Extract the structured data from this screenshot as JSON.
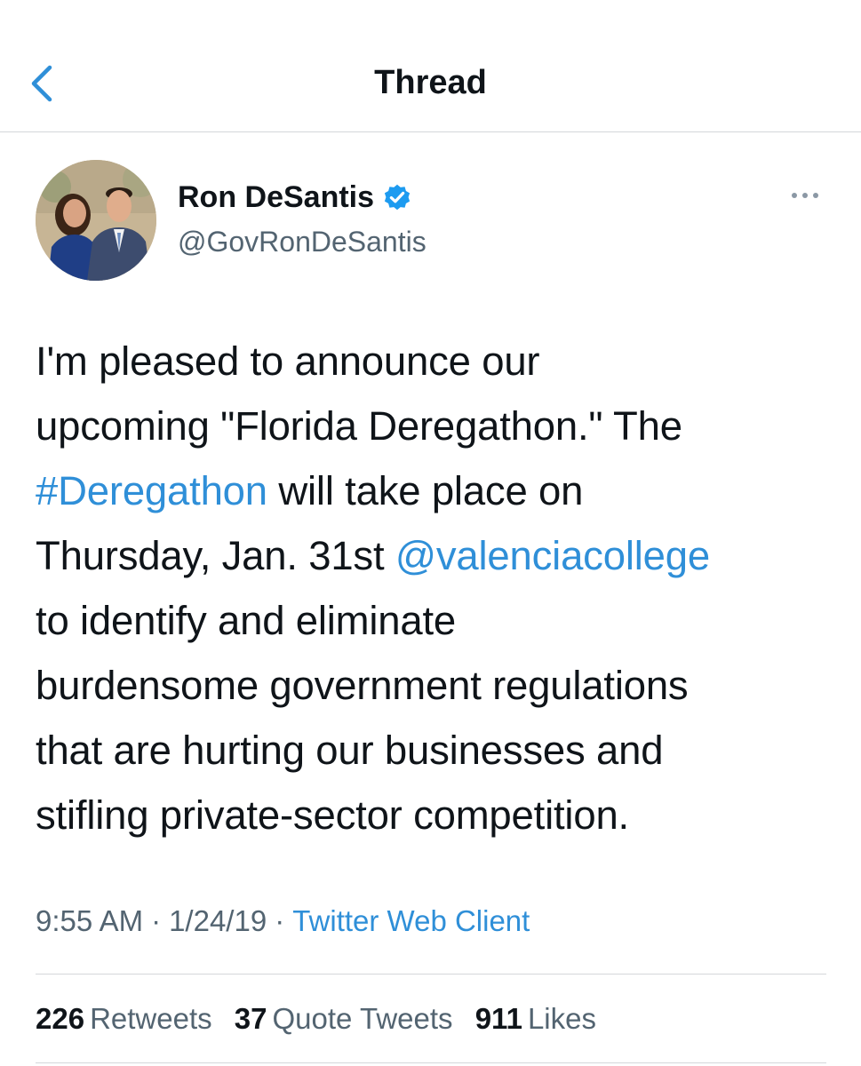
{
  "header": {
    "title": "Thread",
    "back_icon": "chevron-left-icon"
  },
  "author": {
    "display_name": "Ron DeSantis",
    "handle": "@GovRonDeSantis",
    "verified_icon": "verified-badge-icon",
    "more_icon": "more-horizontal-icon"
  },
  "tweet": {
    "segments": [
      {
        "text": "I'm pleased to announce our",
        "type": "text"
      },
      {
        "text": "upcoming \"Florida Deregathon.\" The",
        "type": "text"
      },
      {
        "text": "#Deregathon",
        "type": "hashtag"
      },
      {
        "text": " will take place on",
        "type": "text"
      },
      {
        "text": "Thursday, Jan. 31st ",
        "type": "text"
      },
      {
        "text": "@valenciacollege",
        "type": "mention"
      },
      {
        "text": "to identify and eliminate",
        "type": "text"
      },
      {
        "text": "burdensome government regulations",
        "type": "text"
      },
      {
        "text": "that are hurting our businesses and",
        "type": "text"
      },
      {
        "text": "stifling private-sector competition.",
        "type": "text"
      }
    ]
  },
  "meta": {
    "time": "9:55 AM",
    "separator": "·",
    "date": "1/24/19",
    "client": "Twitter Web Client"
  },
  "stats": {
    "retweets_count": "226",
    "retweets_label": "Retweets",
    "quotes_count": "37",
    "quotes_label": "Quote Tweets",
    "likes_count": "911",
    "likes_label": "Likes"
  },
  "colors": {
    "link": "#2f8fd8",
    "text": "#0f1419",
    "secondary": "#536471",
    "divider": "#d4d7da"
  }
}
